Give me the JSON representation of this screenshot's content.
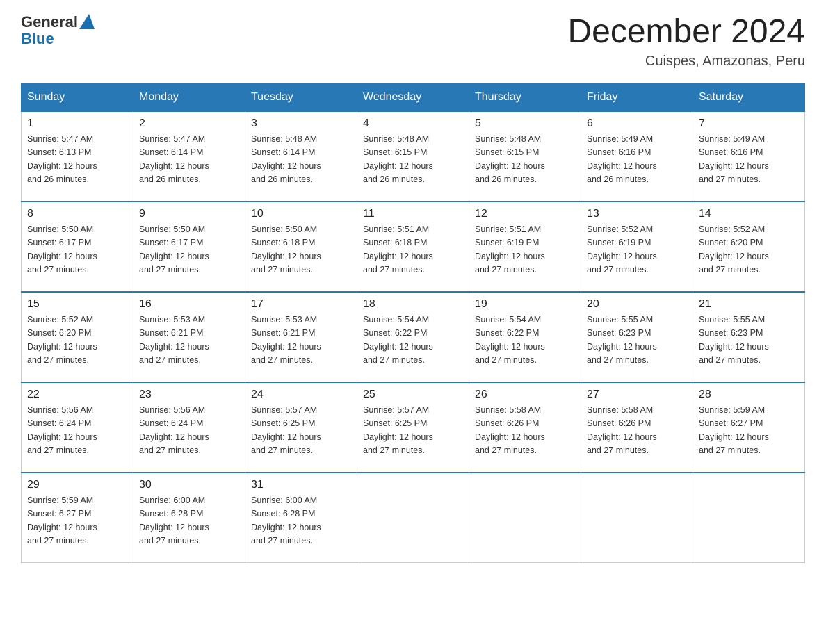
{
  "header": {
    "logo_general": "General",
    "logo_blue": "Blue",
    "month_title": "December 2024",
    "location": "Cuispes, Amazonas, Peru"
  },
  "days_of_week": [
    "Sunday",
    "Monday",
    "Tuesday",
    "Wednesday",
    "Thursday",
    "Friday",
    "Saturday"
  ],
  "weeks": [
    [
      {
        "day": "1",
        "sunrise": "5:47 AM",
        "sunset": "6:13 PM",
        "daylight": "12 hours and 26 minutes."
      },
      {
        "day": "2",
        "sunrise": "5:47 AM",
        "sunset": "6:14 PM",
        "daylight": "12 hours and 26 minutes."
      },
      {
        "day": "3",
        "sunrise": "5:48 AM",
        "sunset": "6:14 PM",
        "daylight": "12 hours and 26 minutes."
      },
      {
        "day": "4",
        "sunrise": "5:48 AM",
        "sunset": "6:15 PM",
        "daylight": "12 hours and 26 minutes."
      },
      {
        "day": "5",
        "sunrise": "5:48 AM",
        "sunset": "6:15 PM",
        "daylight": "12 hours and 26 minutes."
      },
      {
        "day": "6",
        "sunrise": "5:49 AM",
        "sunset": "6:16 PM",
        "daylight": "12 hours and 26 minutes."
      },
      {
        "day": "7",
        "sunrise": "5:49 AM",
        "sunset": "6:16 PM",
        "daylight": "12 hours and 27 minutes."
      }
    ],
    [
      {
        "day": "8",
        "sunrise": "5:50 AM",
        "sunset": "6:17 PM",
        "daylight": "12 hours and 27 minutes."
      },
      {
        "day": "9",
        "sunrise": "5:50 AM",
        "sunset": "6:17 PM",
        "daylight": "12 hours and 27 minutes."
      },
      {
        "day": "10",
        "sunrise": "5:50 AM",
        "sunset": "6:18 PM",
        "daylight": "12 hours and 27 minutes."
      },
      {
        "day": "11",
        "sunrise": "5:51 AM",
        "sunset": "6:18 PM",
        "daylight": "12 hours and 27 minutes."
      },
      {
        "day": "12",
        "sunrise": "5:51 AM",
        "sunset": "6:19 PM",
        "daylight": "12 hours and 27 minutes."
      },
      {
        "day": "13",
        "sunrise": "5:52 AM",
        "sunset": "6:19 PM",
        "daylight": "12 hours and 27 minutes."
      },
      {
        "day": "14",
        "sunrise": "5:52 AM",
        "sunset": "6:20 PM",
        "daylight": "12 hours and 27 minutes."
      }
    ],
    [
      {
        "day": "15",
        "sunrise": "5:52 AM",
        "sunset": "6:20 PM",
        "daylight": "12 hours and 27 minutes."
      },
      {
        "day": "16",
        "sunrise": "5:53 AM",
        "sunset": "6:21 PM",
        "daylight": "12 hours and 27 minutes."
      },
      {
        "day": "17",
        "sunrise": "5:53 AM",
        "sunset": "6:21 PM",
        "daylight": "12 hours and 27 minutes."
      },
      {
        "day": "18",
        "sunrise": "5:54 AM",
        "sunset": "6:22 PM",
        "daylight": "12 hours and 27 minutes."
      },
      {
        "day": "19",
        "sunrise": "5:54 AM",
        "sunset": "6:22 PM",
        "daylight": "12 hours and 27 minutes."
      },
      {
        "day": "20",
        "sunrise": "5:55 AM",
        "sunset": "6:23 PM",
        "daylight": "12 hours and 27 minutes."
      },
      {
        "day": "21",
        "sunrise": "5:55 AM",
        "sunset": "6:23 PM",
        "daylight": "12 hours and 27 minutes."
      }
    ],
    [
      {
        "day": "22",
        "sunrise": "5:56 AM",
        "sunset": "6:24 PM",
        "daylight": "12 hours and 27 minutes."
      },
      {
        "day": "23",
        "sunrise": "5:56 AM",
        "sunset": "6:24 PM",
        "daylight": "12 hours and 27 minutes."
      },
      {
        "day": "24",
        "sunrise": "5:57 AM",
        "sunset": "6:25 PM",
        "daylight": "12 hours and 27 minutes."
      },
      {
        "day": "25",
        "sunrise": "5:57 AM",
        "sunset": "6:25 PM",
        "daylight": "12 hours and 27 minutes."
      },
      {
        "day": "26",
        "sunrise": "5:58 AM",
        "sunset": "6:26 PM",
        "daylight": "12 hours and 27 minutes."
      },
      {
        "day": "27",
        "sunrise": "5:58 AM",
        "sunset": "6:26 PM",
        "daylight": "12 hours and 27 minutes."
      },
      {
        "day": "28",
        "sunrise": "5:59 AM",
        "sunset": "6:27 PM",
        "daylight": "12 hours and 27 minutes."
      }
    ],
    [
      {
        "day": "29",
        "sunrise": "5:59 AM",
        "sunset": "6:27 PM",
        "daylight": "12 hours and 27 minutes."
      },
      {
        "day": "30",
        "sunrise": "6:00 AM",
        "sunset": "6:28 PM",
        "daylight": "12 hours and 27 minutes."
      },
      {
        "day": "31",
        "sunrise": "6:00 AM",
        "sunset": "6:28 PM",
        "daylight": "12 hours and 27 minutes."
      },
      null,
      null,
      null,
      null
    ]
  ]
}
